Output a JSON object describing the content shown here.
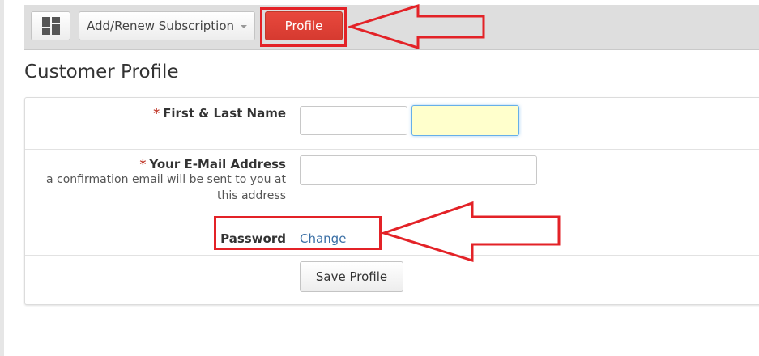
{
  "toolbar": {
    "dashboard_icon": "grid-icon",
    "subscription_label": "Add/Renew Subscription",
    "subscription_caret_icon": "caret-down-icon",
    "profile_label": "Profile"
  },
  "page": {
    "title": "Customer Profile"
  },
  "form": {
    "name_row": {
      "required_mark": "*",
      "label": "First & Last Name",
      "first_value": "",
      "last_value": ""
    },
    "email_row": {
      "required_mark": "*",
      "label": "Your E-Mail Address",
      "help_text": "a confirmation email will be sent to you at this address",
      "value": ""
    },
    "password_row": {
      "label": "Password",
      "change_link": "Change"
    },
    "save_label": "Save Profile"
  },
  "colors": {
    "accent_red": "#d63a30",
    "annotation_red": "#e32227",
    "link_blue": "#3a6fa5",
    "focused_field": "#ffffcc"
  }
}
